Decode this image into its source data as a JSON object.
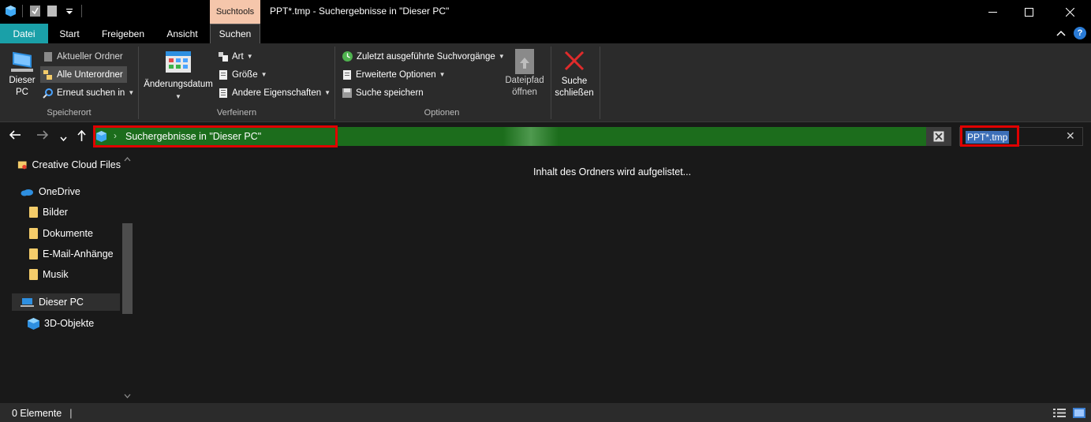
{
  "title_bar": {
    "window_title": "PPT*.tmp - Suchergebnisse in \"Dieser PC\"",
    "contextual_tab": "Suchtools",
    "minimize": "—",
    "maximize": "☐",
    "close": "✕"
  },
  "tabs": [
    {
      "label": "Datei"
    },
    {
      "label": "Start"
    },
    {
      "label": "Freigeben"
    },
    {
      "label": "Ansicht"
    },
    {
      "label": "Suchen"
    }
  ],
  "ribbon": {
    "speicherort": {
      "group_label": "Speicherort",
      "dieser_pc": "Dieser PC",
      "aktueller_ordner": "Aktueller Ordner",
      "alle_unterordner": "Alle Unterordner",
      "erneut_suchen": "Erneut suchen in"
    },
    "verfeinern": {
      "group_label": "Verfeinern",
      "aenderungsdatum": "Änderungsdatum",
      "art": "Art",
      "groesse": "Größe",
      "andere_eigenschaften": "Andere Eigenschaften"
    },
    "optionen": {
      "group_label": "Optionen",
      "zuletzt": "Zuletzt ausgeführte Suchvorgänge",
      "erweiterte": "Erweiterte Optionen",
      "speichern": "Suche speichern",
      "dateipfad_1": "Dateipfad",
      "dateipfad_2": "öffnen"
    },
    "schliessen": {
      "line1": "Suche",
      "line2": "schließen"
    }
  },
  "address_bar": {
    "path_label": "Suchergebnisse in \"Dieser PC\""
  },
  "search_box": {
    "query": "PPT*.tmp"
  },
  "nav_pane": {
    "items": [
      {
        "label": "Creative Cloud Files"
      },
      {
        "label": "OneDrive"
      },
      {
        "label": "Bilder"
      },
      {
        "label": "Dokumente"
      },
      {
        "label": "E-Mail-Anhänge"
      },
      {
        "label": "Musik"
      },
      {
        "label": "Dieser PC"
      },
      {
        "label": "3D-Objekte"
      }
    ]
  },
  "content": {
    "loading_message": "Inhalt des Ordners wird aufgelistet..."
  },
  "status_bar": {
    "item_count": "0 Elemente"
  },
  "colors": {
    "accent_datei_tab": "#1aa0a8",
    "contextual_tab": "#f5c6ab",
    "address_progress": "#1c6d1c",
    "highlight_box": "#e00000",
    "search_selection": "#3d6fb8"
  }
}
